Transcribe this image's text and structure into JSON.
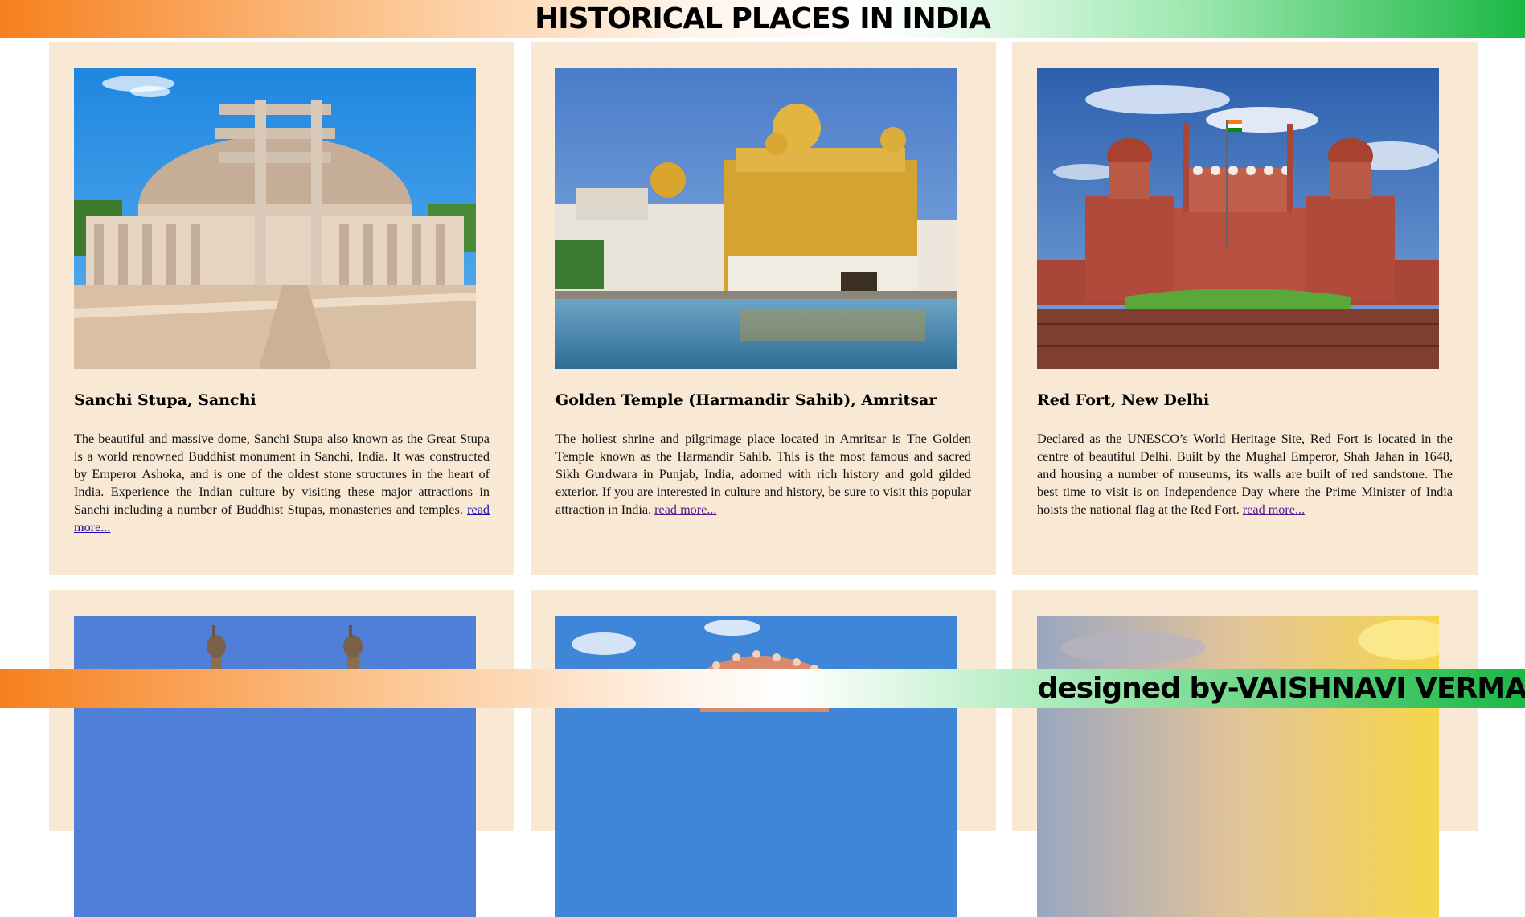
{
  "header": {
    "title": "HISTORICAL PLACES IN INDIA"
  },
  "footer": {
    "credit": "designed by-VAISHNAVI VERMA"
  },
  "cards": [
    {
      "title": "Sanchi Stupa, Sanchi",
      "description": "The beautiful and massive dome, Sanchi Stupa also known as the Great Stupa is a world renowned Buddhist monument in Sanchi, India. It was constructed by Emperor Ashoka, and is one of the oldest stone structures in the heart of India. Experience the Indian culture by visiting these major attractions in Sanchi including a number of Buddhist Stupas, monasteries and temples.",
      "link_label": "read more..."
    },
    {
      "title": "Golden Temple (Harmandir Sahib), Amritsar",
      "description": "The holiest shrine and pilgrimage place located in Amritsar is The Golden Temple known as the Harmandir Sahib. This is the most famous and sacred Sikh Gurdwara in Punjab, India, adorned with rich history and gold gilded exterior. If you are interested in culture and history, be sure to visit this popular attraction in India.",
      "link_label": "read more..."
    },
    {
      "title": "Red Fort, New Delhi",
      "description": "Declared as the UNESCO’s World Heritage Site, Red Fort is located in the centre of beautiful Delhi. Built by the Mughal Emperor, Shah Jahan in 1648, and housing a number of museums, its walls are built of red sandstone. The best time to visit is on Independence Day where the Prime Minister of India hoists the national flag at the Red Fort.",
      "link_label": "read more..."
    }
  ],
  "colors": {
    "card_background": "#f8e8d4",
    "saffron": "#f7801e",
    "green": "#1bb845",
    "link": "#1a0dab",
    "link_visited": "#551a8b"
  }
}
